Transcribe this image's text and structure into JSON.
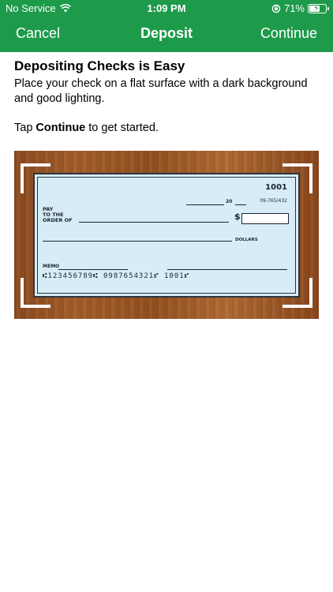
{
  "status_bar": {
    "carrier": "No Service",
    "time": "1:09 PM",
    "battery_percent": "71%",
    "battery_level": 0.71,
    "icons": [
      "wifi-icon",
      "orientation-lock-icon",
      "battery-charging-icon"
    ]
  },
  "nav": {
    "cancel_label": "Cancel",
    "title": "Deposit",
    "continue_label": "Continue"
  },
  "content": {
    "heading": "Depositing Checks is Easy",
    "description": "Place your check on a flat surface with a dark background and good lighting.",
    "tap_prefix": "Tap ",
    "tap_bold": "Continue",
    "tap_suffix": " to get started."
  },
  "check": {
    "number": "1001",
    "routing": "09-765/432",
    "date_year": "20",
    "pay_line1": "PAY",
    "pay_line2": "TO THE",
    "pay_line3": "ORDER OF",
    "dollar_sign": "$",
    "dollars_label": "DOLLARS",
    "memo_label": "MEMO",
    "micr": "⑆123456789⑆  0987654321⑈  1001⑈"
  },
  "colors": {
    "header_green": "#1e9a4b",
    "check_blue": "#d7ecf6",
    "wood": "#a35d2a"
  }
}
